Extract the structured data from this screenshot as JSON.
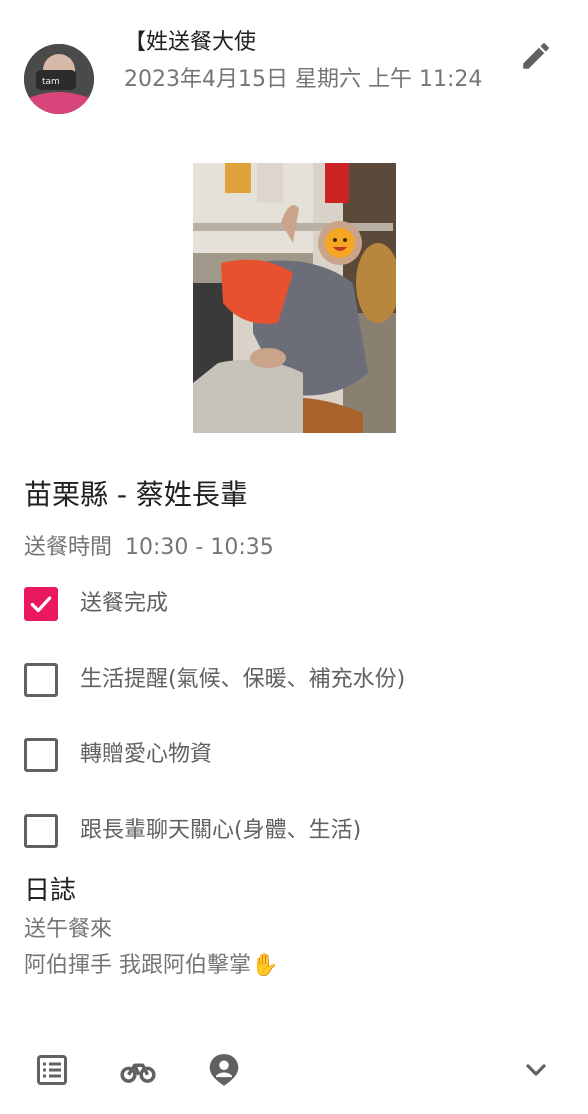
{
  "post": {
    "author": "【姓送餐大使",
    "datetime": "2023年4月15日 星期六 上午 11:24",
    "edit_icon": "pencil-icon"
  },
  "title": "苗栗縣 - 蔡姓長輩",
  "delivery_time": {
    "label": "送餐時間",
    "value": "10:30 - 10:35"
  },
  "checklist": [
    {
      "label": "送餐完成",
      "checked": true
    },
    {
      "label": "生活提醒(氣候、保暖、補充水份)",
      "checked": false
    },
    {
      "label": "轉贈愛心物資",
      "checked": false
    },
    {
      "label": "跟長輩聊天關心(身體、生活)",
      "checked": false
    }
  ],
  "journal": {
    "title": "日誌",
    "lines": [
      "送午餐來",
      "阿伯揮手 我跟阿伯擊掌✋"
    ]
  },
  "toolbar": {
    "icons": [
      "list-icon",
      "bicycle-icon",
      "person-pin-icon",
      "chevron-down-icon"
    ]
  },
  "colors": {
    "accent": "#e9195d",
    "text_primary": "#212121",
    "text_secondary": "#757575",
    "icon": "#616161"
  }
}
